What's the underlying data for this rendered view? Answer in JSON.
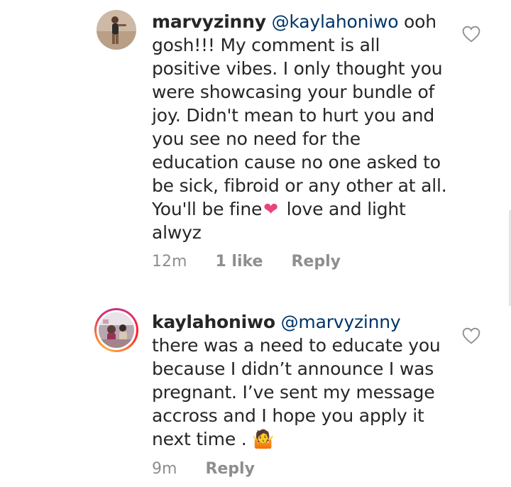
{
  "comments": [
    {
      "username": "marvyzinny",
      "mention": "@kaylahoniwo",
      "text_before_heart": " ooh gosh!!! My comment is all positive vibes. I only thought you were showcasing your bundle of joy. Didn't mean to hurt you and you see no need for the education cause no one asked to be sick, fibroid or any other at all. You'll be fine",
      "text_after_heart": " love and light alwyz",
      "time": "12m",
      "likes": "1 like",
      "reply_label": "Reply",
      "heart_icon": "heart-emoji",
      "accent_color": "#e8457a"
    },
    {
      "username": "kaylahoniwo",
      "mention": "@marvyzinny",
      "text": " there was a need to educate you because I didn’t announce I was pregnant. I’ve sent my message accross and I hope you apply it next time . 🤷",
      "time": "9m",
      "reply_label": "Reply",
      "story_ring": true
    }
  ],
  "colors": {
    "text": "#262626",
    "mention": "#003569",
    "meta": "#8e8e8e"
  }
}
